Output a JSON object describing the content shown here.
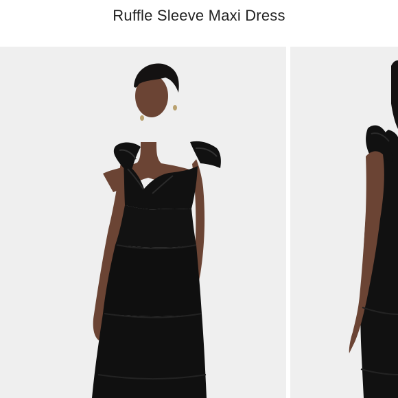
{
  "product": {
    "title": "Ruffle Sleeve Maxi Dress"
  },
  "gallery": {
    "images": [
      {
        "name": "model-front-image"
      },
      {
        "name": "model-side-image"
      }
    ]
  },
  "colors": {
    "background": "#ffffff",
    "photo_background": "#efefef",
    "dress": "#111111",
    "skin": "#6b4434",
    "hair": "#141212",
    "title_text": "#222222"
  }
}
